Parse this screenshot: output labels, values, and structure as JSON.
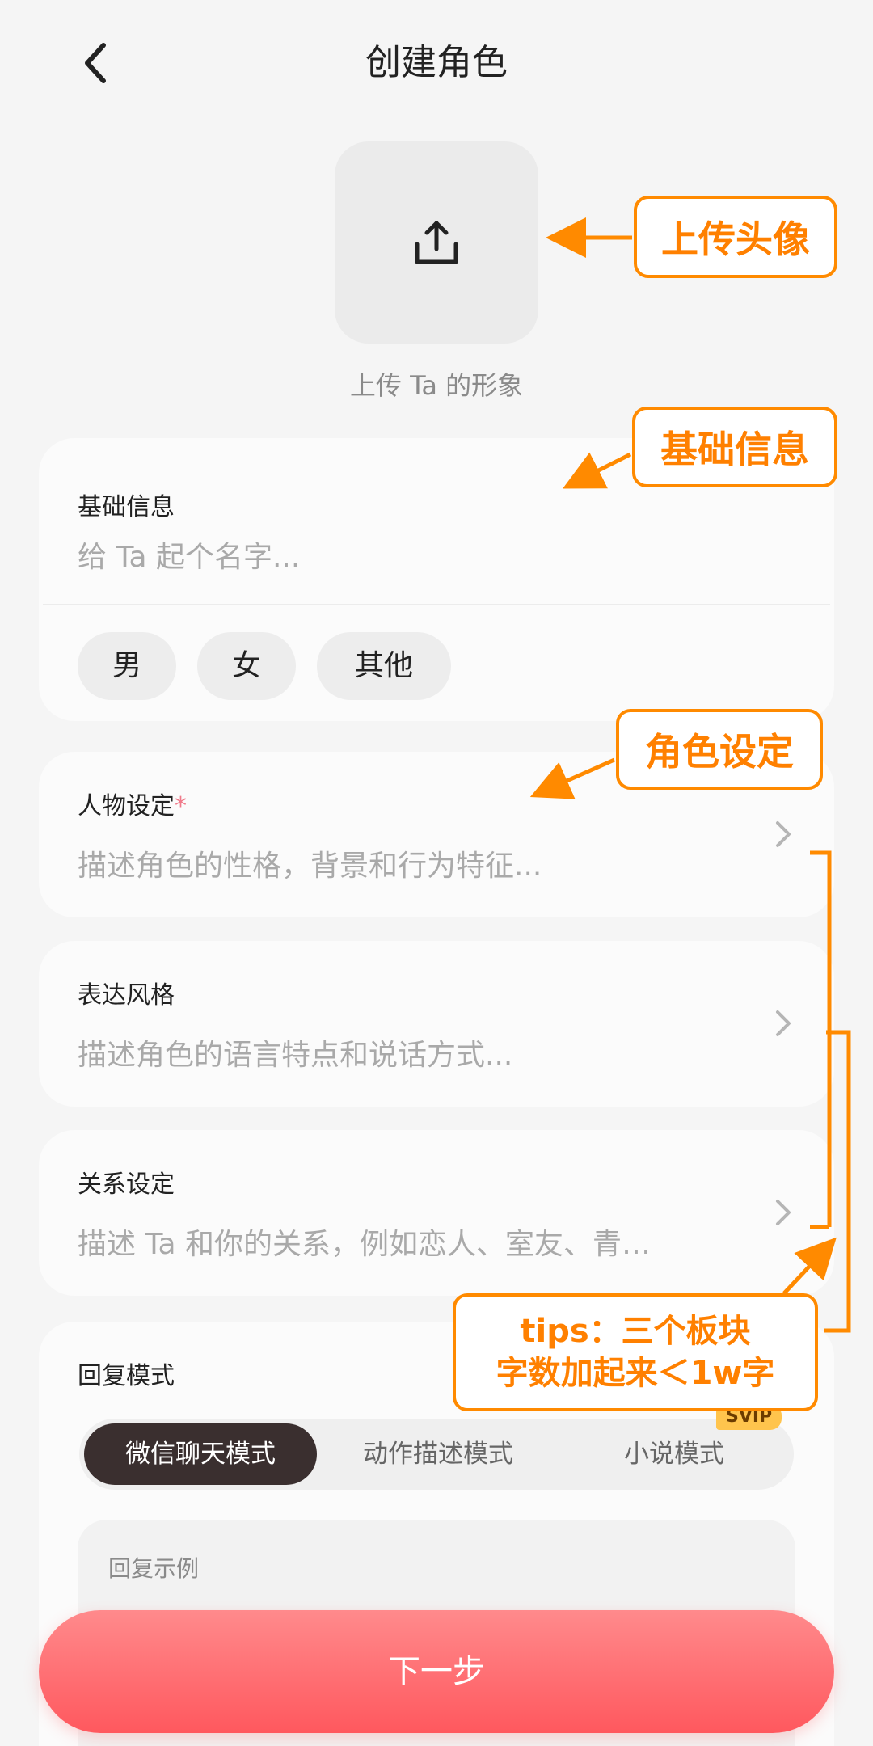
{
  "header": {
    "title": "创建角色"
  },
  "avatar": {
    "caption": "上传 Ta 的形象"
  },
  "basic_info": {
    "label": "基础信息",
    "name_placeholder": "给 Ta 起个名字...",
    "genders": [
      "男",
      "女",
      "其他"
    ]
  },
  "persona": {
    "label": "人物设定",
    "required_mark": "*",
    "placeholder": "描述角色的性格，背景和行为特征..."
  },
  "expression": {
    "label": "表达风格",
    "placeholder": "描述角色的语言特点和说话方式..."
  },
  "relationship": {
    "label": "关系设定",
    "placeholder": "描述 Ta 和你的关系，例如恋人、室友、青…"
  },
  "reply_mode": {
    "label": "回复模式",
    "options": [
      "微信聊天模式",
      "动作描述模式",
      "小说模式"
    ],
    "selected": "微信聊天模式",
    "svip_badge": "SVIP",
    "example_label": "回复示例"
  },
  "footer": {
    "next_label": "下一步"
  },
  "annotations": {
    "avatar": "上传头像",
    "basic": "基础信息",
    "role": "角色设定",
    "tips_line1": "tips：三个板块",
    "tips_line2": "字数加起来＜1w字"
  },
  "colors": {
    "accent_orange": "#ff8a00",
    "next_button": "#ff6b6f",
    "active_mode": "#3a2f2f",
    "svip": "#ffc44d"
  }
}
